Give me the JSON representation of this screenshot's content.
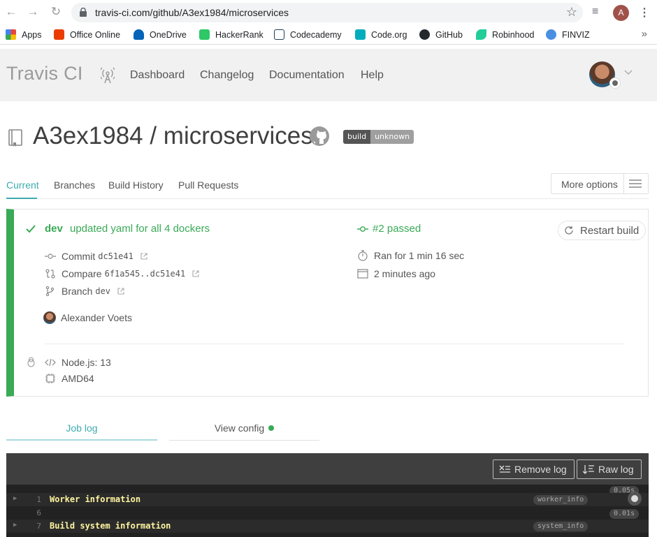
{
  "browser": {
    "url": "travis-ci.com/github/A3ex1984/microservices",
    "profile_initial": "A",
    "bookmarks": [
      {
        "label": "Apps",
        "color": "#e8453c"
      },
      {
        "label": "Office Online",
        "color": "#eb3c00"
      },
      {
        "label": "OneDrive",
        "color": "#0364b8"
      },
      {
        "label": "HackerRank",
        "color": "#2ec866"
      },
      {
        "label": "Codecademy",
        "color": "#1f4056"
      },
      {
        "label": "Code.org",
        "color": "#00adbc"
      },
      {
        "label": "GitHub",
        "color": "#24292e"
      },
      {
        "label": "Robinhood",
        "color": "#21ce99"
      },
      {
        "label": "FINVIZ",
        "color": "#4a90e2"
      }
    ],
    "bookmarks_more": "»"
  },
  "header": {
    "logo": "Travis CI",
    "nav": [
      "Dashboard",
      "Changelog",
      "Documentation",
      "Help"
    ]
  },
  "repo": {
    "title": "A3ex1984 / microservices",
    "badge_left": "build",
    "badge_right": "unknown"
  },
  "tabs": {
    "items": [
      "Current",
      "Branches",
      "Build History",
      "Pull Requests"
    ],
    "more_options": "More options"
  },
  "build": {
    "branch": "dev",
    "message": "updated yaml for all 4 dockers",
    "status": "#2 passed",
    "restart_label": "Restart build",
    "commit_label": "Commit",
    "commit_sha": "dc51e41",
    "compare_label": "Compare",
    "compare_range": "6f1a545..dc51e41",
    "branch_label": "Branch",
    "branch_value": "dev",
    "author": "Alexander Voets",
    "duration": "Ran for 1 min 16 sec",
    "finished": "2 minutes ago",
    "language": "Node.js: 13",
    "arch": "AMD64",
    "status_color": "#39aa56"
  },
  "log_tabs": {
    "job_log": "Job log",
    "view_config": "View config"
  },
  "log": {
    "remove_label": "Remove log",
    "raw_label": "Raw log",
    "lines": [
      {
        "num": "1",
        "text": "Worker information",
        "tag": "worker_info",
        "time": "0.05s"
      },
      {
        "num": "6",
        "text": "",
        "tag": "",
        "time": ""
      },
      {
        "num": "7",
        "text": "Build system information",
        "tag": "system_info",
        "time": "0.01s"
      }
    ]
  }
}
